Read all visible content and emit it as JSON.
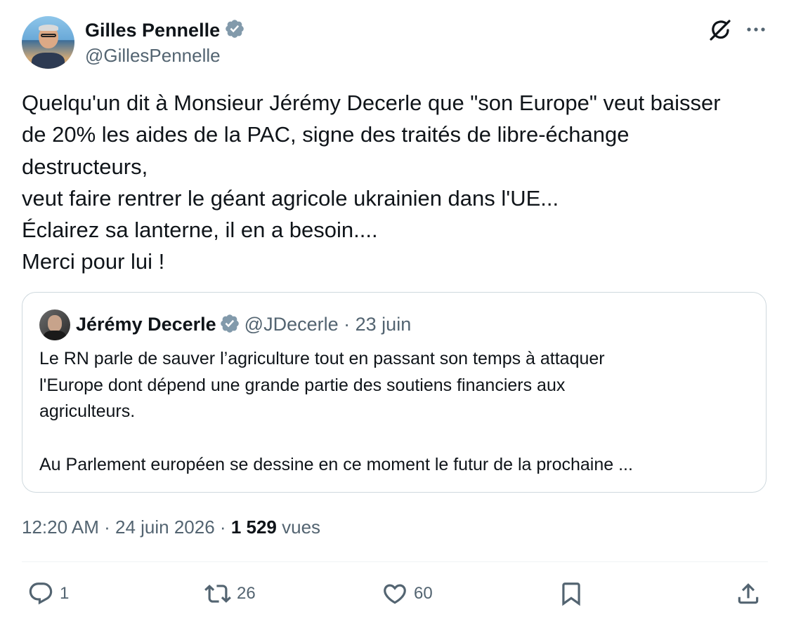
{
  "author": {
    "name": "Gilles Pennelle",
    "handle": "@GillesPennelle",
    "verified": true
  },
  "tweet": {
    "text": "Quelqu'un dit à Monsieur Jérémy Decerle que \"son Europe\" veut baisser\nde 20% les aides de la PAC, signe des traités de libre-échange\ndestructeurs,\nveut faire rentrer le géant agricole ukrainien dans l'UE...\nÉclairez sa lanterne, il en a besoin....\nMerci pour lui !"
  },
  "quote": {
    "name": "Jérémy Decerle",
    "handle": "@JDecerle",
    "separator": "·",
    "date": "23 juin",
    "text": "Le RN parle de sauver l’agriculture tout en passant son temps à attaquer\nl'Europe dont dépend une grande partie des soutiens financiers aux\nagriculteurs.\n\nAu Parlement européen se dessine en ce moment le futur de la prochaine ..."
  },
  "meta": {
    "time": "12:20 AM",
    "separator": "·",
    "date": "24 juin 2026",
    "views_count": "1 529",
    "views_label": "vues"
  },
  "actions": {
    "replies": "1",
    "retweets": "26",
    "likes": "60"
  },
  "colors": {
    "text_primary": "#0f1419",
    "text_secondary": "#536471",
    "border": "#cfd9de",
    "verified_badge": "#829aab"
  },
  "icons": [
    "verified-badge-icon",
    "grok-icon",
    "more-icon",
    "reply-icon",
    "retweet-icon",
    "like-icon",
    "bookmark-icon",
    "share-icon"
  ]
}
